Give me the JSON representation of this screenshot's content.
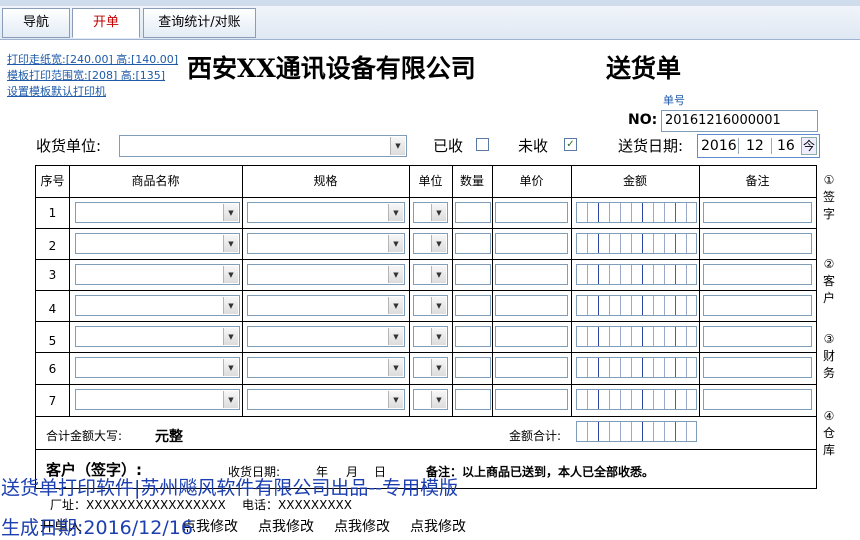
{
  "tabs": {
    "nav": "导航",
    "open": "开单",
    "query": "查询统计/对账"
  },
  "links": {
    "paper_size": "打印走纸宽:[240.00] 高:[140.00]",
    "template_range": "模板打印范围宽:[208] 高:[135]",
    "default_printer": "设置模板默认打印机"
  },
  "header": {
    "company": "西安XX通讯设备有限公司",
    "doc_title": "送货单",
    "order_no_caption": "单号",
    "order_no_label": "NO:",
    "order_no_value": "20161216000001"
  },
  "form": {
    "receiver_label": "收货单位:",
    "received_label": "已收",
    "unreceived_label": "未收",
    "date_label": "送货日期:",
    "date_year": "2016",
    "date_month": "12",
    "date_day": "16",
    "spin_label": "今"
  },
  "table": {
    "headers": {
      "seq": "序号",
      "name": "商品名称",
      "spec": "规格",
      "unit": "单位",
      "qty": "数量",
      "price": "单价",
      "amount": "金额",
      "remark": "备注"
    },
    "rows": [
      "1",
      "2",
      "3",
      "4",
      "5",
      "6",
      "7"
    ],
    "total_caps_label": "合计金额大写:",
    "total_caps_value": "元整",
    "total_label": "金额合计:"
  },
  "signature": {
    "customer_sign": "客户（签字）:",
    "receive_date": "收货日期:",
    "year": "年",
    "month": "月",
    "day": "日",
    "note": "备注：以上商品已送到，本人已全部收悉。"
  },
  "side_notes": {
    "n1": "① 签 字",
    "n2": "② 客 户",
    "n3": "③ 财 务",
    "n4": "④ 仓 库"
  },
  "footer": {
    "address": "厂址：XXXXXXXXXXXXXXXXX",
    "phone": "电话：XXXXXXXXX",
    "maker_partial": "开单人",
    "edit1": "点我修改",
    "edit2": "点我修改",
    "edit3": "点我修改",
    "edit4": "点我修改"
  },
  "overlay": {
    "line1": "送货单打印软件|苏州飚风软件有限公司出品--专用模版",
    "line2": "生成日期:2016/12/16"
  },
  "colors": {
    "tab_active_text": "#c00000",
    "link": "#1e5aa8",
    "overlay": "#1b3fb0",
    "money_red": "#d23030"
  }
}
